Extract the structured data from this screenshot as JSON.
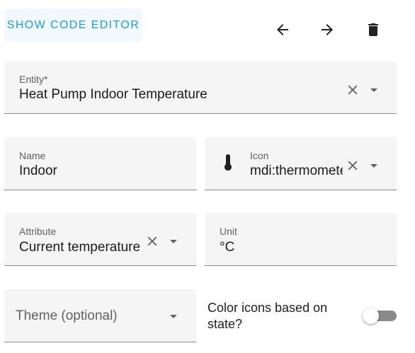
{
  "toolbar": {
    "code_editor_label": "SHOW CODE EDITOR",
    "back_icon": "arrow-left-icon",
    "forward_icon": "arrow-right-icon",
    "delete_icon": "trash-icon"
  },
  "fields": {
    "entity": {
      "label": "Entity*",
      "value": "Heat Pump Indoor Temperature"
    },
    "name": {
      "label": "Name",
      "value": "Indoor"
    },
    "icon": {
      "label": "Icon",
      "value": "mdi:thermometer",
      "prefix_icon": "thermometer-icon"
    },
    "attribute": {
      "label": "Attribute",
      "value": "Current temperature"
    },
    "unit": {
      "label": "Unit",
      "value": "°C"
    },
    "theme": {
      "label": "Theme (optional)"
    }
  },
  "switch": {
    "label": "Color icons based on state?",
    "checked": false
  },
  "colors": {
    "accent": "#1e9be9",
    "field_bg": "#f5f5f5",
    "icon": "#212121"
  }
}
